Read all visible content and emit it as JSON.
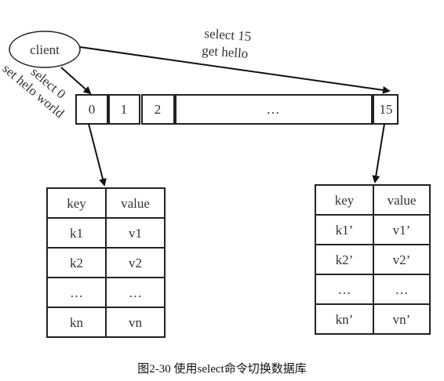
{
  "client_label": "client",
  "left_command": [
    "select 0",
    "set helo world"
  ],
  "right_command": [
    "select 15",
    "get hello"
  ],
  "databases": [
    "0",
    "1",
    "2",
    "…",
    "15"
  ],
  "left_table": {
    "headers": [
      "key",
      "value"
    ],
    "rows": [
      [
        "k1",
        "v1"
      ],
      [
        "k2",
        "v2"
      ],
      [
        "…",
        "…"
      ],
      [
        "kn",
        "vn"
      ]
    ]
  },
  "right_table": {
    "headers": [
      "key",
      "value"
    ],
    "rows": [
      [
        "k1’",
        "v1’"
      ],
      [
        "k2’",
        "v2’"
      ],
      [
        "…",
        "…"
      ],
      [
        "kn’",
        "vn’"
      ]
    ]
  },
  "caption": "图2-30    使用select命令切换数据库"
}
